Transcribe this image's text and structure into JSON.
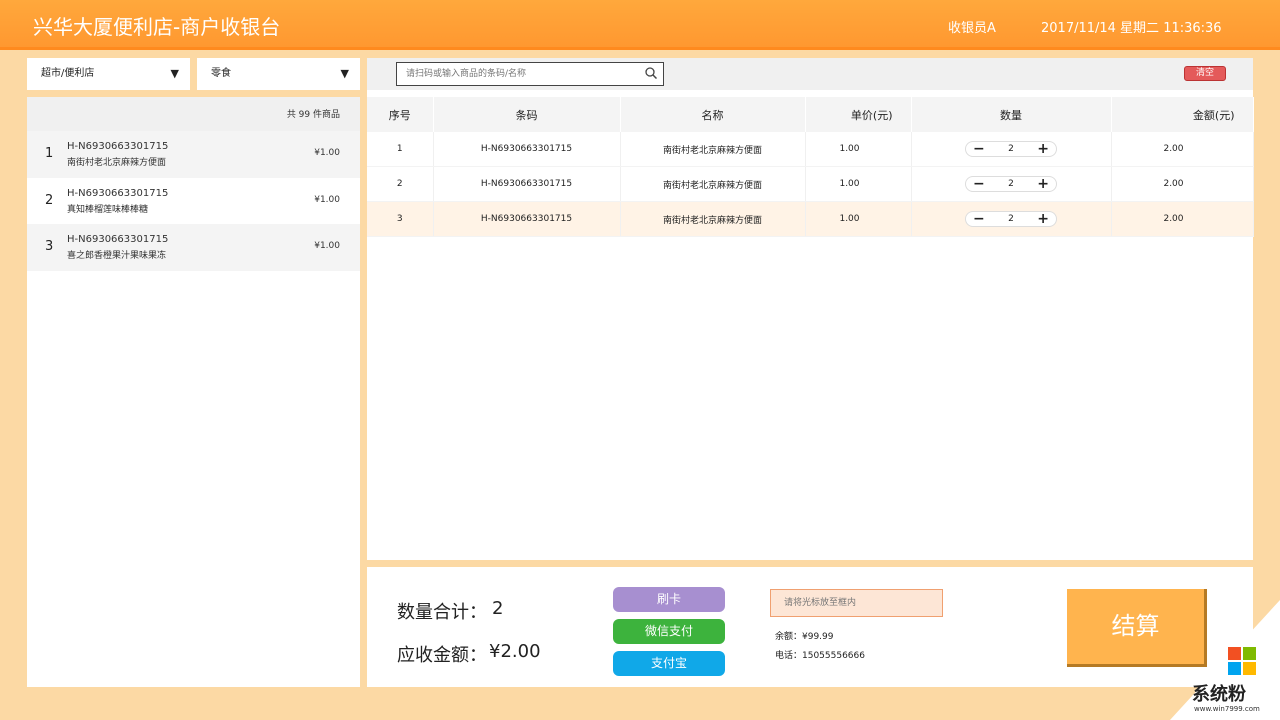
{
  "header": {
    "title": "兴华大厦便利店-商户收银台",
    "cashier": "收银员A",
    "datetime": "2017/11/14 星期二 11:36:36"
  },
  "filters": {
    "category1": "超市/便利店",
    "category2": "零食"
  },
  "product_list": {
    "count_label": "共 99 件商品",
    "items": [
      {
        "num": "1",
        "code": "H-N6930663301715",
        "name": "南街村老北京麻辣方便面",
        "price": "¥1.00"
      },
      {
        "num": "2",
        "code": "H-N6930663301715",
        "name": "真知棒榴莲味棒棒糖",
        "price": "¥1.00"
      },
      {
        "num": "3",
        "code": "H-N6930663301715",
        "name": "喜之郎香橙果汁果味果冻",
        "price": "¥1.00"
      }
    ]
  },
  "search": {
    "placeholder": "请扫码或输入商品的条码/名称",
    "clear_label": "清空"
  },
  "cart": {
    "columns": [
      "序号",
      "条码",
      "名称",
      "单价(元)",
      "数量",
      "金额(元)"
    ],
    "rows": [
      {
        "seq": "1",
        "barcode": "H-N6930663301715",
        "name": "南街村老北京麻辣方便面",
        "unit_price": "1.00",
        "qty": "2",
        "amount": "2.00"
      },
      {
        "seq": "2",
        "barcode": "H-N6930663301715",
        "name": "南街村老北京麻辣方便面",
        "unit_price": "1.00",
        "qty": "2",
        "amount": "2.00"
      },
      {
        "seq": "3",
        "barcode": "H-N6930663301715",
        "name": "南街村老北京麻辣方便面",
        "unit_price": "1.00",
        "qty": "2",
        "amount": "2.00"
      }
    ]
  },
  "summary": {
    "qty_label": "数量合计：",
    "qty_value": "2",
    "amount_label": "应收金额：",
    "amount_value": "¥2.00"
  },
  "payment": {
    "card_label": "刷卡",
    "wechat_label": "微信支付",
    "alipay_label": "支付宝",
    "card_input_placeholder": "请将光标放至框内",
    "balance": "余额：¥99.99",
    "phone": "电话：15055556666",
    "checkout_label": "结算"
  },
  "watermark": {
    "text": "系统粉",
    "url": "www.win7999.com"
  },
  "colors": {
    "header": "#ff9830",
    "card_btn": "#a78fd0",
    "wechat_btn": "#3db33d",
    "alipay_btn": "#10a8e8",
    "checkout": "#ffb44e"
  }
}
